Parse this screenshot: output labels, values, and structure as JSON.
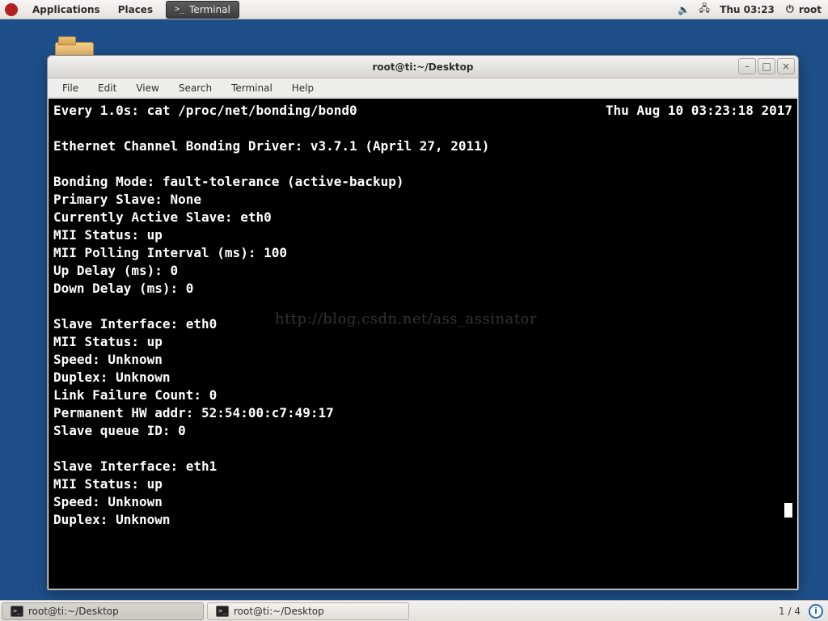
{
  "top_panel": {
    "menus": {
      "applications": "Applications",
      "places": "Places"
    },
    "task_button_label": "Terminal",
    "clock": "Thu 03:23",
    "user": "root"
  },
  "window": {
    "title": "root@ti:~/Desktop",
    "menus": {
      "file": "File",
      "edit": "Edit",
      "view": "View",
      "search": "Search",
      "terminal": "Terminal",
      "help": "Help"
    }
  },
  "terminal": {
    "watch_left": "Every 1.0s: cat /proc/net/bonding/bond0",
    "watch_right": "Thu Aug 10 03:23:18 2017",
    "body": "\nEthernet Channel Bonding Driver: v3.7.1 (April 27, 2011)\n\nBonding Mode: fault-tolerance (active-backup)\nPrimary Slave: None\nCurrently Active Slave: eth0\nMII Status: up\nMII Polling Interval (ms): 100\nUp Delay (ms): 0\nDown Delay (ms): 0\n\nSlave Interface: eth0\nMII Status: up\nSpeed: Unknown\nDuplex: Unknown\nLink Failure Count: 0\nPermanent HW addr: 52:54:00:c7:49:17\nSlave queue ID: 0\n\nSlave Interface: eth1\nMII Status: up\nSpeed: Unknown\nDuplex: Unknown"
  },
  "watermark": "http://blog.csdn.net/ass_assinator",
  "bottom_panel": {
    "tasks": [
      {
        "label": "root@ti:~/Desktop",
        "active": true
      },
      {
        "label": "root@ti:~/Desktop",
        "active": false
      }
    ],
    "pager": "1 / 4"
  },
  "icons": {
    "minimize": "–",
    "maximize": "□",
    "close": "×",
    "sound": "🔈",
    "network": "🖧",
    "power": "⏻"
  }
}
